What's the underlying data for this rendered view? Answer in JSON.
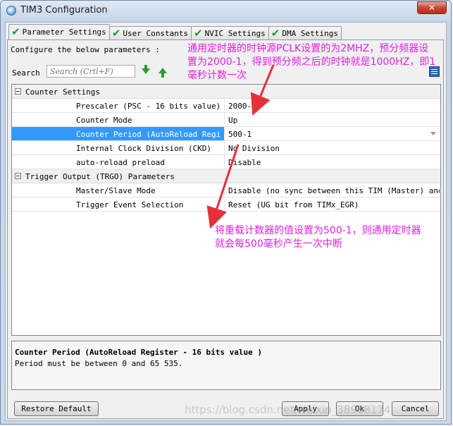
{
  "window": {
    "title": "TIM3 Configuration",
    "close_label": "✕"
  },
  "tabs": [
    {
      "label": "Parameter Settings",
      "active": true
    },
    {
      "label": "User Constants",
      "active": false
    },
    {
      "label": "NVIC Settings",
      "active": false
    },
    {
      "label": "DMA Settings",
      "active": false
    }
  ],
  "configure_text": "Configure the below parameters :",
  "search": {
    "label": "Search :",
    "placeholder": "Search (Crtl+F)"
  },
  "groups": [
    {
      "name": "Counter Settings",
      "params": [
        {
          "name": "Prescaler (PSC - 16 bits value)",
          "value": "2000-1"
        },
        {
          "name": "Counter Mode",
          "value": "Up"
        },
        {
          "name": "Counter Period (AutoReload Regis...",
          "value": "500-1"
        },
        {
          "name": "Internal Clock Division (CKD)",
          "value": "No Division"
        },
        {
          "name": "auto-reload preload",
          "value": "Disable"
        }
      ]
    },
    {
      "name": "Trigger Output (TRGO) Parameters",
      "params": [
        {
          "name": "Master/Slave Mode",
          "value": "Disable (no sync between this TIM (Master) and ..."
        },
        {
          "name": "Trigger Event Selection",
          "value": "Reset (UG bit from TIMx_EGR)"
        }
      ]
    }
  ],
  "description": {
    "title": "Counter Period (AutoReload Register - 16 bits value )",
    "body": "Period must be between 0 and 65 535."
  },
  "buttons": {
    "restore_default": "Restore Default",
    "apply": "Apply",
    "ok": "Ok",
    "cancel": "Cancel"
  },
  "annotations": {
    "top": "通用定时器的时钟源PCLK设置的为2MHZ，预分频器设\n置为2000-1，得到预分频之后的时钟就是1000HZ，即1\n毫秒计数一次",
    "bottom": "将重载计数器的值设置为500-1，则通用定时器\n就会每500毫秒产生一次中断"
  },
  "watermark": "https://blog.csdn.net/weixin_38968174",
  "colors": {
    "selection": "#3399ff",
    "annotation": "#e020e0",
    "check": "#1f9a2f"
  }
}
